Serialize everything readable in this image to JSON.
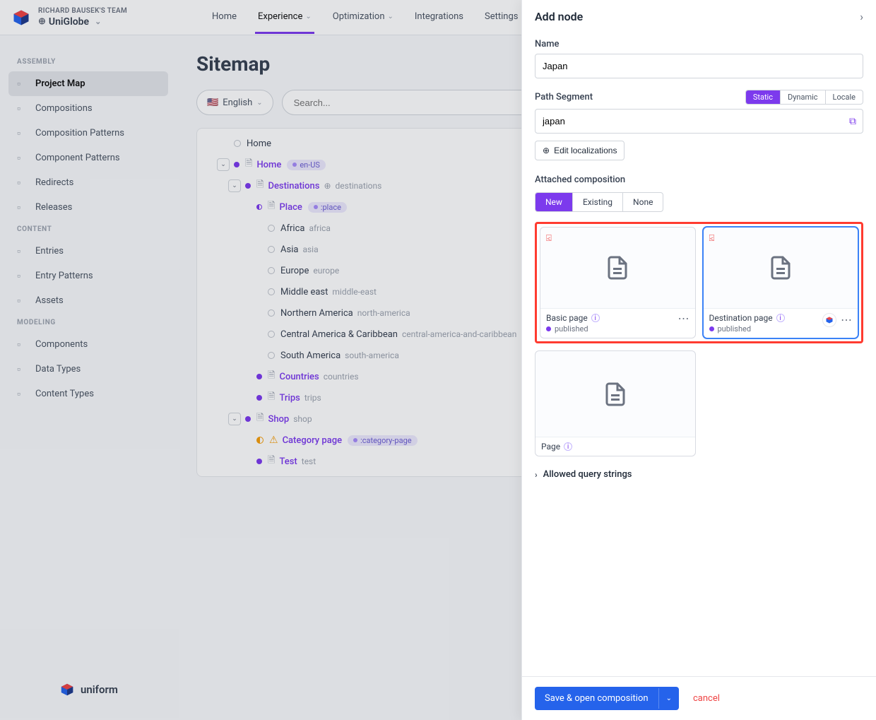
{
  "header": {
    "team_label": "RICHARD BAUSEK'S TEAM",
    "project": "UniGlobe",
    "nav": [
      "Home",
      "Experience",
      "Optimization",
      "Integrations",
      "Settings"
    ],
    "active_nav": "Experience"
  },
  "sidebar": {
    "groups": [
      {
        "label": "ASSEMBLY",
        "items": [
          {
            "label": "Project Map",
            "active": true,
            "icon": "project-map-icon"
          },
          {
            "label": "Compositions",
            "icon": "compositions-icon"
          },
          {
            "label": "Composition Patterns",
            "icon": "composition-patterns-icon"
          },
          {
            "label": "Component Patterns",
            "icon": "component-patterns-icon"
          },
          {
            "label": "Redirects",
            "icon": "redirects-icon"
          },
          {
            "label": "Releases",
            "icon": "releases-icon"
          }
        ]
      },
      {
        "label": "CONTENT",
        "items": [
          {
            "label": "Entries",
            "icon": "entries-icon"
          },
          {
            "label": "Entry Patterns",
            "icon": "entry-patterns-icon"
          },
          {
            "label": "Assets",
            "icon": "assets-icon"
          }
        ]
      },
      {
        "label": "MODELING",
        "items": [
          {
            "label": "Components",
            "icon": "components-icon"
          },
          {
            "label": "Data Types",
            "icon": "data-types-icon"
          },
          {
            "label": "Content Types",
            "icon": "content-types-icon"
          }
        ]
      }
    ]
  },
  "page": {
    "title": "Sitemap",
    "language": "English",
    "search_placeholder": "Search..."
  },
  "tree": [
    {
      "indent": 0,
      "toggle": false,
      "status": "empty",
      "label": "Home",
      "link": false
    },
    {
      "indent": 0,
      "toggle": true,
      "status": "full-purple",
      "pageIcon": true,
      "label": "Home",
      "link": true,
      "pill": "en-US"
    },
    {
      "indent": 1,
      "toggle": true,
      "status": "full-purple",
      "pageIcon": true,
      "label": "Destinations",
      "link": true,
      "slug": "destinations",
      "slugGlobe": true
    },
    {
      "indent": 2,
      "toggle": false,
      "status": "half-purple",
      "pageIcon": true,
      "label": "Place",
      "link": true,
      "pill": ":place"
    },
    {
      "indent": 3,
      "toggle": false,
      "status": "empty",
      "label": "Africa",
      "link": false,
      "slug": "africa"
    },
    {
      "indent": 3,
      "toggle": false,
      "status": "empty",
      "label": "Asia",
      "link": false,
      "slug": "asia"
    },
    {
      "indent": 3,
      "toggle": false,
      "status": "empty",
      "label": "Europe",
      "link": false,
      "slug": "europe"
    },
    {
      "indent": 3,
      "toggle": false,
      "status": "empty",
      "label": "Middle east",
      "link": false,
      "slug": "middle-east"
    },
    {
      "indent": 3,
      "toggle": false,
      "status": "empty",
      "label": "Northern America",
      "link": false,
      "slug": "north-america"
    },
    {
      "indent": 3,
      "toggle": false,
      "status": "empty",
      "label": "Central America & Caribbean",
      "link": false,
      "slug": "central-america-and-caribbean"
    },
    {
      "indent": 3,
      "toggle": false,
      "status": "empty",
      "label": "South America",
      "link": false,
      "slug": "south-america"
    },
    {
      "indent": 2,
      "toggle": false,
      "status": "full-purple",
      "pageIcon": true,
      "label": "Countries",
      "link": true,
      "slug": "countries"
    },
    {
      "indent": 2,
      "toggle": false,
      "status": "full-purple",
      "pageIcon": true,
      "label": "Trips",
      "link": true,
      "slug": "trips"
    },
    {
      "indent": 1,
      "toggle": true,
      "status": "full-purple",
      "pageIcon": true,
      "label": "Shop",
      "link": true,
      "slug": "shop"
    },
    {
      "indent": 2,
      "toggle": false,
      "status": "half-orange",
      "warn": true,
      "label": "Category page",
      "link": true,
      "pill": ":category-page"
    },
    {
      "indent": 2,
      "toggle": false,
      "status": "full-purple",
      "pageIcon": true,
      "label": "Test",
      "link": true,
      "slug": "test"
    }
  ],
  "panel": {
    "title": "Add node",
    "name_label": "Name",
    "name_value": "Japan",
    "path_label": "Path Segment",
    "path_segments": [
      "Static",
      "Dynamic",
      "Locale"
    ],
    "path_active": "Static",
    "path_value": "japan",
    "edit_localizations": "Edit localizations",
    "attached_heading": "Attached composition",
    "tabs": [
      "New",
      "Existing",
      "None"
    ],
    "active_tab": "New",
    "cards": [
      {
        "title": "Basic page",
        "status": "published",
        "selected": false,
        "highlighted": true,
        "info": true
      },
      {
        "title": "Destination page",
        "status": "published",
        "selected": true,
        "highlighted": true,
        "info": true,
        "showLogo": true
      },
      {
        "title": "Page",
        "status": null,
        "selected": false,
        "highlighted": false,
        "info": true
      }
    ],
    "allowed_query": "Allowed query strings",
    "save_label": "Save & open composition",
    "cancel_label": "cancel"
  },
  "footer_brand": "uniform"
}
